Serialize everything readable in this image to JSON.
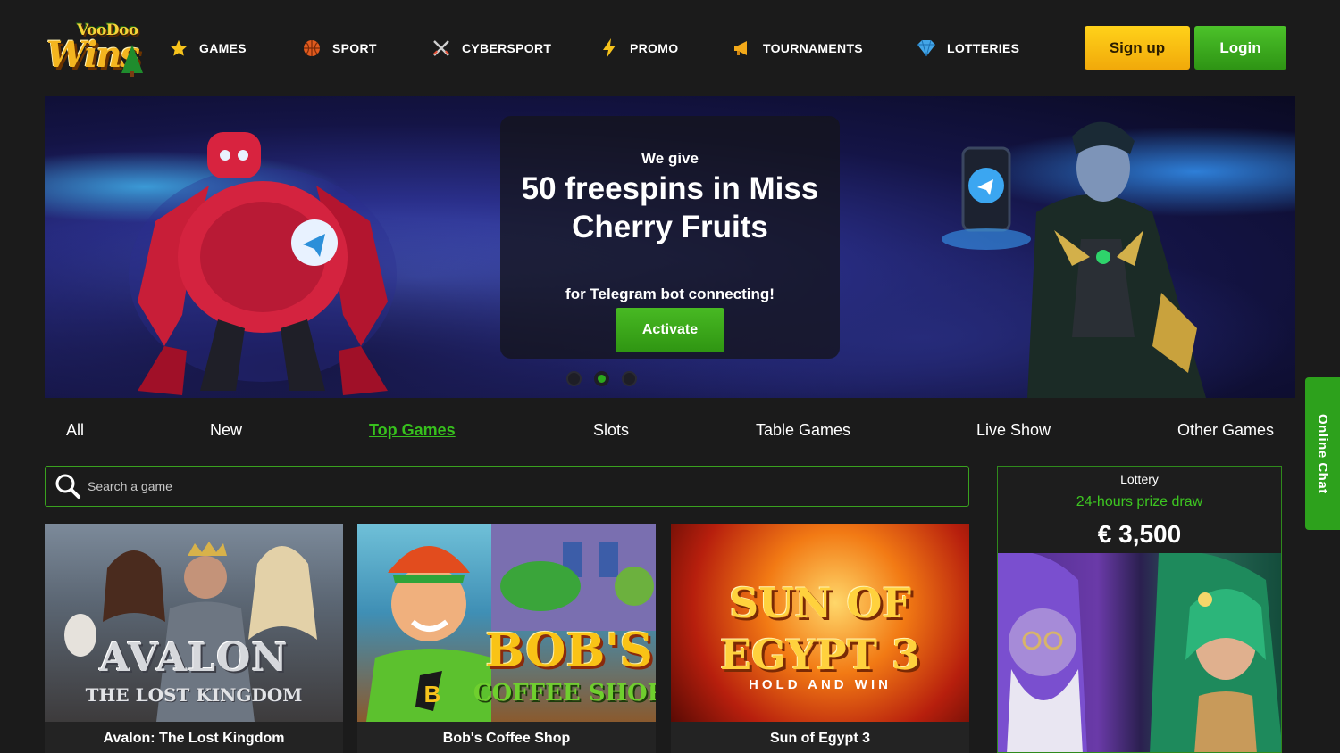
{
  "brand": {
    "logo_top": "VooDoo",
    "logo_main": "Wins"
  },
  "nav": [
    {
      "label": "GAMES",
      "icon": "star-icon"
    },
    {
      "label": "SPORT",
      "icon": "ball-icon"
    },
    {
      "label": "CYBERSPORT",
      "icon": "crossed-swords-icon"
    },
    {
      "label": "PROMO",
      "icon": "lightning-icon"
    },
    {
      "label": "TOURNAMENTS",
      "icon": "megaphone-icon"
    },
    {
      "label": "LOTTERIES",
      "icon": "gem-icon"
    }
  ],
  "auth": {
    "signup_label": "Sign up",
    "login_label": "Login"
  },
  "banner": {
    "small_text": "We give",
    "headline": "50 freespins in Miss Cherry Fruits",
    "subtext": "for Telegram bot connecting!",
    "button_label": "Activate",
    "slides_count": 3,
    "active_slide": 2
  },
  "categories": [
    {
      "label": "All",
      "active": false
    },
    {
      "label": "New",
      "active": false
    },
    {
      "label": "Top Games",
      "active": true
    },
    {
      "label": "Slots",
      "active": false
    },
    {
      "label": "Table Games",
      "active": false
    },
    {
      "label": "Live Show",
      "active": false
    },
    {
      "label": "Other Games",
      "active": false
    }
  ],
  "search": {
    "placeholder": "Search a game"
  },
  "games": [
    {
      "name": "Avalon: The Lost Kingdom",
      "art_line1": "AVALON",
      "art_line2": "THE LOST KINGDOM"
    },
    {
      "name": "Bob's Coffee Shop",
      "art_line1": "BOB'S",
      "art_line2": "COFFEE SHOP"
    },
    {
      "name": "Sun of Egypt 3",
      "art_line1": "SUN OF EGYPT 3",
      "art_line2": "HOLD AND WIN"
    }
  ],
  "lottery": {
    "title": "Lottery",
    "subtitle": "24-hours prize draw",
    "amount": "€ 3,500"
  },
  "chat": {
    "label": "Online Chat"
  },
  "colors": {
    "accent_green": "#2da11c",
    "signup_yellow": "#ffc414",
    "background": "#1b1b1b"
  }
}
